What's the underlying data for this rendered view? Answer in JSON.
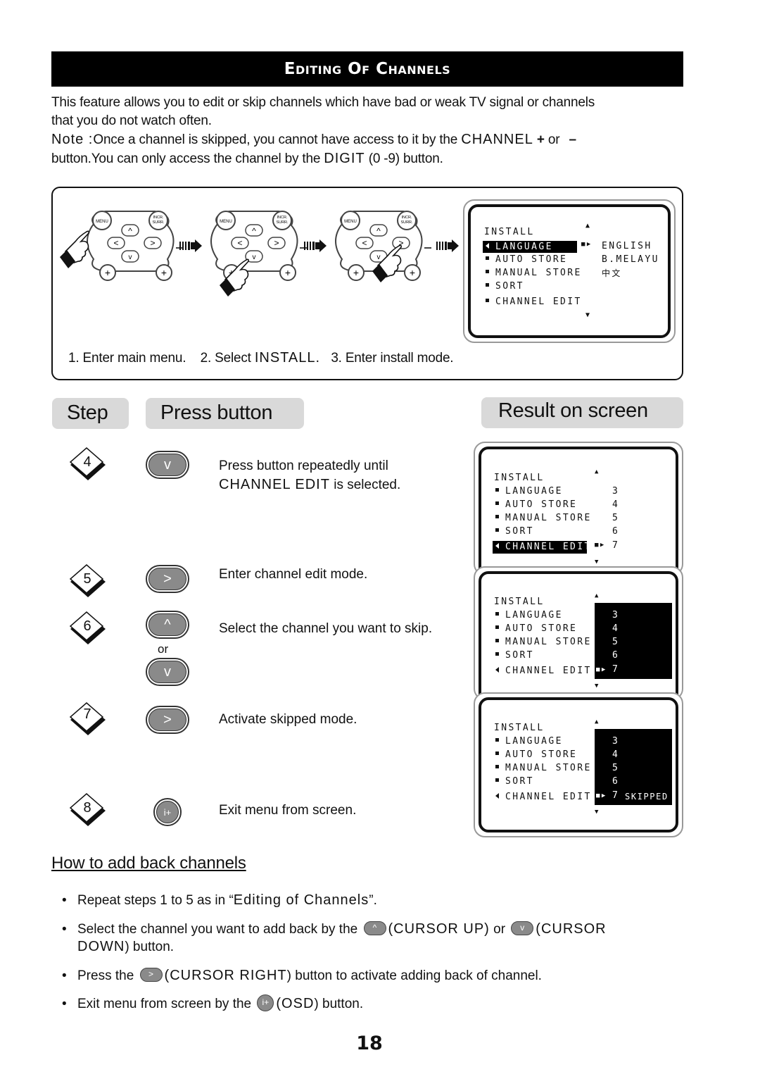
{
  "title": "Editing Of Channels",
  "intro": {
    "line1": "This feature allows you to edit or skip channels which have bad or weak TV signal or channels",
    "line2": "that you do not watch often.",
    "note_label": "Note :",
    "note_text1": "Once a channel is skipped, you cannot have access to it by the ",
    "note_caps1": "CHANNEL",
    "note_plus": "+",
    "note_or": " or ",
    "note_minus": "–",
    "note_text2": "button.You can only access the channel by the ",
    "note_caps2": "DIGIT",
    "note_text3": " (0 -9) button."
  },
  "diagram": {
    "remotes": [
      {
        "menu": "MENU",
        "incr": "INCR.",
        "surr": "SURR.",
        "pressed": "menu"
      },
      {
        "menu": "MENU",
        "incr": "INCR.",
        "surr": "SURR.",
        "pressed": "down"
      },
      {
        "menu": "MENU",
        "incr": "INCR.",
        "surr": "SURR.",
        "pressed": "right"
      }
    ],
    "captions": {
      "c1": "1. Enter main menu.",
      "c2a": "2.  Select ",
      "c2b": "INSTALL.",
      "c3": "3.  Enter install mode."
    },
    "osd": {
      "title": "INSTALL",
      "items": [
        "LANGUAGE",
        "AUTO STORE",
        "MANUAL STORE",
        "SORT",
        "CHANNEL EDIT"
      ],
      "selected": "LANGUAGE",
      "options": [
        "ENGLISH",
        "B.MELAYU",
        "中文"
      ]
    }
  },
  "headers": {
    "step": "Step",
    "press": "Press button",
    "result": "Result on screen"
  },
  "steps": [
    {
      "number": "4",
      "buttons": [
        "v"
      ],
      "text_a": "Press button repeatedly until",
      "text_caps": "CHANNEL EDIT",
      "text_b": " is selected."
    },
    {
      "number": "5",
      "buttons": [
        ">"
      ],
      "text": "Enter channel edit mode."
    },
    {
      "number": "6",
      "buttons": [
        "^",
        "v"
      ],
      "or": "or",
      "text": "Select the channel you want to skip."
    },
    {
      "number": "7",
      "buttons": [
        ">"
      ],
      "text": "Activate skipped mode."
    },
    {
      "number": "8",
      "buttons": [
        "i+"
      ],
      "text": "Exit menu from screen."
    }
  ],
  "result_screens": [
    {
      "title": "INSTALL",
      "items": [
        "LANGUAGE",
        "AUTO STORE",
        "MANUAL STORE",
        "SORT",
        "CHANNEL EDIT"
      ],
      "values": [
        "3",
        "4",
        "5",
        "6",
        "7"
      ],
      "selected": "CHANNEL EDIT",
      "status": ""
    },
    {
      "title": "INSTALL",
      "items": [
        "LANGUAGE",
        "AUTO STORE",
        "MANUAL STORE",
        "SORT",
        "CHANNEL EDIT"
      ],
      "values": [
        "3",
        "4",
        "5",
        "6",
        "7"
      ],
      "selected": "values",
      "status": ""
    },
    {
      "title": "INSTALL",
      "items": [
        "LANGUAGE",
        "AUTO STORE",
        "MANUAL STORE",
        "SORT",
        "CHANNEL EDIT"
      ],
      "values": [
        "3",
        "4",
        "5",
        "6",
        "7"
      ],
      "selected": "values",
      "status": "SKIPPED"
    }
  ],
  "add_back": {
    "title": "How to add back channels",
    "bullets": {
      "b1a": "Repeat steps 1 to 5 as in “",
      "b1caps": "Editing of Channels",
      "b1b": "”.",
      "b2a": "Select the channel you want to add back by the",
      "b2caps1": "(CURSOR UP)",
      "b2b": " or ",
      "b2caps2": "(CURSOR",
      "b2caps3": "DOWN",
      "b2c": ") button.",
      "b3a": "Press the",
      "b3caps": "(CURSOR RIGHT",
      "b3b": ") button to activate adding back of channel.",
      "b4a": "Exit menu from screen by the",
      "b4caps": "(OSD",
      "b4b": ") button."
    },
    "icons": {
      "up": "^",
      "down": "v",
      "right": ">",
      "osd": "i+"
    }
  },
  "page_number": "18"
}
